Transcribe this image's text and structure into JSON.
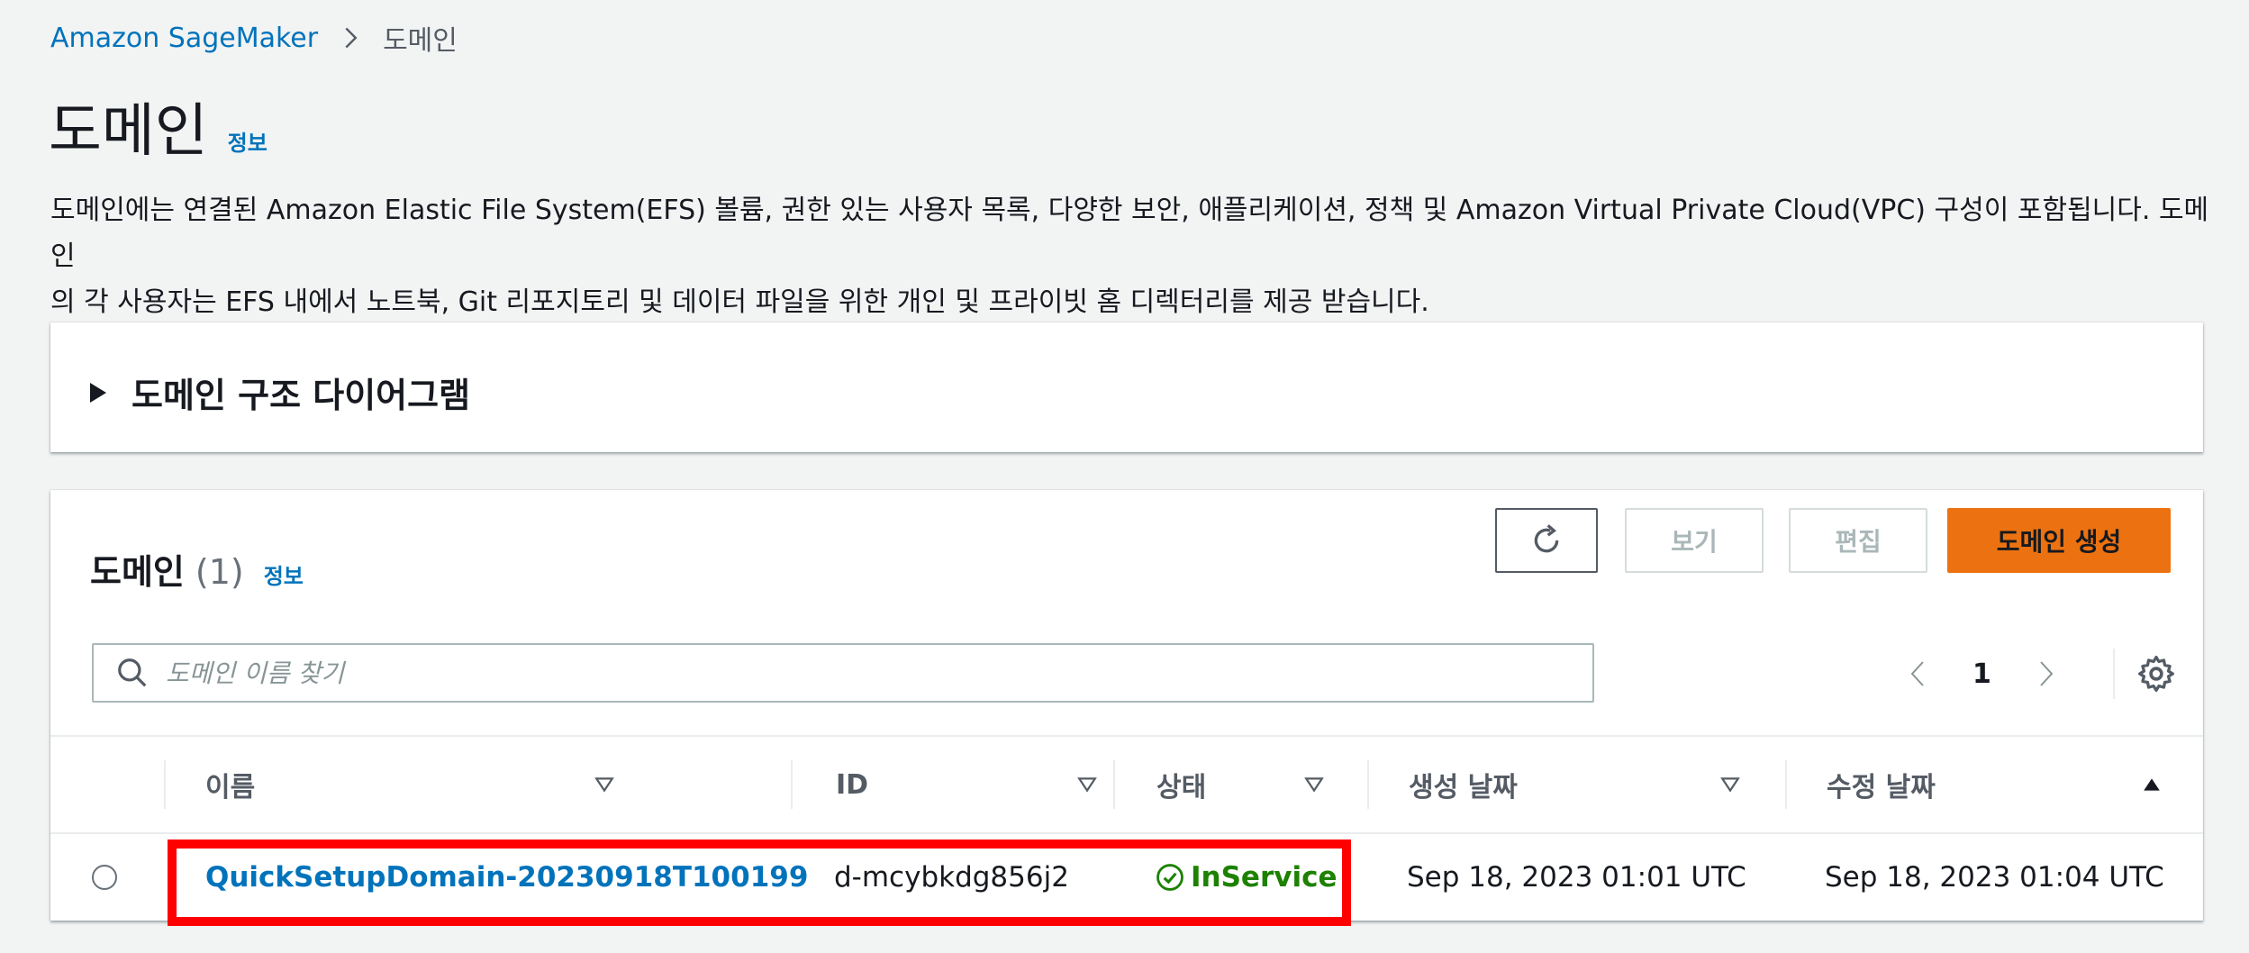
{
  "breadcrumb": {
    "root": "Amazon SageMaker",
    "current": "도메인"
  },
  "page": {
    "title": "도메인",
    "info_label": "정보",
    "description_line1": "도메인에는 연결된 Amazon Elastic File System(EFS) 볼륨, 권한 있는 사용자 목록, 다양한 보안, 애플리케이션, 정책 및 Amazon Virtual Private Cloud(VPC) 구성이 포함됩니다. 도메인",
    "description_line2": "의 각 사용자는 EFS 내에서 노트북, Git 리포지토리 및 데이터 파일을 위한 개인 및 프라이빗 홈 디렉터리를 제공 받습니다."
  },
  "diagram_panel": {
    "label": "도메인 구조 다이어그램"
  },
  "domains_table": {
    "title": "도메인",
    "count": "(1)",
    "info_label": "정보",
    "buttons": {
      "view": "보기",
      "edit": "편집",
      "create": "도메인 생성"
    },
    "search_placeholder": "도메인 이름 찾기",
    "pagination": {
      "current_page": "1"
    },
    "columns": {
      "name": "이름",
      "id": "ID",
      "status": "상태",
      "created": "생성 날짜",
      "modified": "수정 날짜"
    },
    "rows": [
      {
        "name": "QuickSetupDomain-20230918T100199",
        "id": "d-mcybkdg856j2",
        "status": "InService",
        "created": "Sep 18, 2023 01:01 UTC",
        "modified": "Sep 18, 2023 01:04 UTC"
      }
    ]
  },
  "colors": {
    "link": "#0073bb",
    "primary_button": "#ec7211",
    "status_success": "#1d8102",
    "highlight_box": "#ff0000",
    "background": "#f2f3f3"
  },
  "icons": {
    "breadcrumb_separator": "chevron-right-icon",
    "refresh": "refresh-icon",
    "search": "search-icon",
    "prev": "chevron-left-icon",
    "next": "chevron-right-icon",
    "settings": "gear-icon",
    "status": "check-circle-icon",
    "sort": "sort-down-icon",
    "sort_active": "sort-up-icon"
  }
}
